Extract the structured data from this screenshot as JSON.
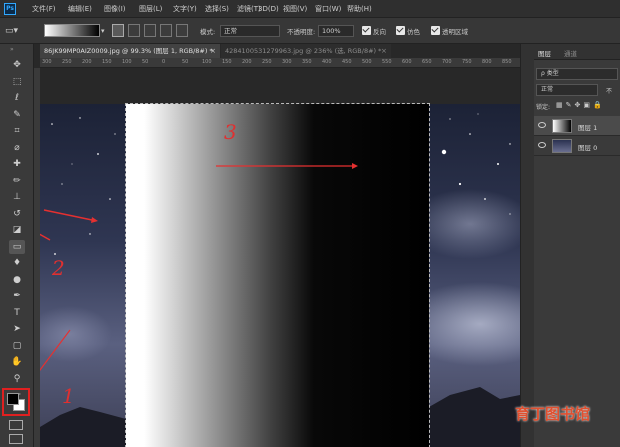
{
  "app": {
    "logo": "Ps"
  },
  "menu": [
    "文件(F)",
    "编辑(E)",
    "图像(I)",
    "图层(L)",
    "文字(Y)",
    "选择(S)",
    "滤镜(T)",
    "3D(D)",
    "视图(V)",
    "窗口(W)",
    "帮助(H)"
  ],
  "options": {
    "mode_label": "模式:",
    "mode_value": "正常",
    "opacity_label": "不透明度:",
    "opacity_value": "100%",
    "reverse_label": "反向",
    "dither_label": "仿色",
    "transparency_label": "透明区域"
  },
  "tabs": [
    {
      "label": "86JK99MP0AIZ0009.jpg @ 99.3% (图层 1, RGB/8#) *",
      "close": "×",
      "active": true
    },
    {
      "label": "4284100531279963.jpg @ 236% (选, RGB/8#) *",
      "close": "×",
      "active": false
    }
  ],
  "ruler_ticks": [
    "300",
    "250",
    "200",
    "150",
    "100",
    "50",
    "0",
    "50",
    "100",
    "150",
    "200",
    "250",
    "300",
    "350",
    "400",
    "450",
    "500",
    "550",
    "600",
    "650",
    "700",
    "750",
    "800",
    "850"
  ],
  "tools": [
    {
      "name": "move-tool",
      "glyph": "✥"
    },
    {
      "name": "marquee-tool",
      "glyph": "⬚"
    },
    {
      "name": "lasso-tool",
      "glyph": "ℓ"
    },
    {
      "name": "quick-select-tool",
      "glyph": "✎"
    },
    {
      "name": "crop-tool",
      "glyph": "⌗"
    },
    {
      "name": "eyedropper-tool",
      "glyph": "⌀"
    },
    {
      "name": "healing-tool",
      "glyph": "✚"
    },
    {
      "name": "brush-tool",
      "glyph": "✏"
    },
    {
      "name": "stamp-tool",
      "glyph": "⊥"
    },
    {
      "name": "history-brush-tool",
      "glyph": "↺"
    },
    {
      "name": "eraser-tool",
      "glyph": "◪"
    },
    {
      "name": "gradient-tool",
      "glyph": "▭"
    },
    {
      "name": "blur-tool",
      "glyph": "♦"
    },
    {
      "name": "dodge-tool",
      "glyph": "●"
    },
    {
      "name": "pen-tool",
      "glyph": "✒"
    },
    {
      "name": "type-tool",
      "glyph": "T"
    },
    {
      "name": "path-select-tool",
      "glyph": "➤"
    },
    {
      "name": "shape-tool",
      "glyph": "▢"
    },
    {
      "name": "hand-tool",
      "glyph": "✋"
    },
    {
      "name": "zoom-tool",
      "glyph": "⚲"
    },
    {
      "name": "more-tools",
      "glyph": "···"
    }
  ],
  "panels": {
    "tab_layers": "图层",
    "tab_channels": "通道",
    "filter_label": "ρ 类型",
    "blend_mode": "正常",
    "opacity_short": "不",
    "lock_label": "锁定:",
    "layers": [
      {
        "name": "图层 1",
        "selected": true
      },
      {
        "name": "图层 0",
        "selected": false
      }
    ]
  },
  "annotations": {
    "one": "1",
    "two": "2",
    "three": "3"
  },
  "watermark": "育丁图书馆"
}
